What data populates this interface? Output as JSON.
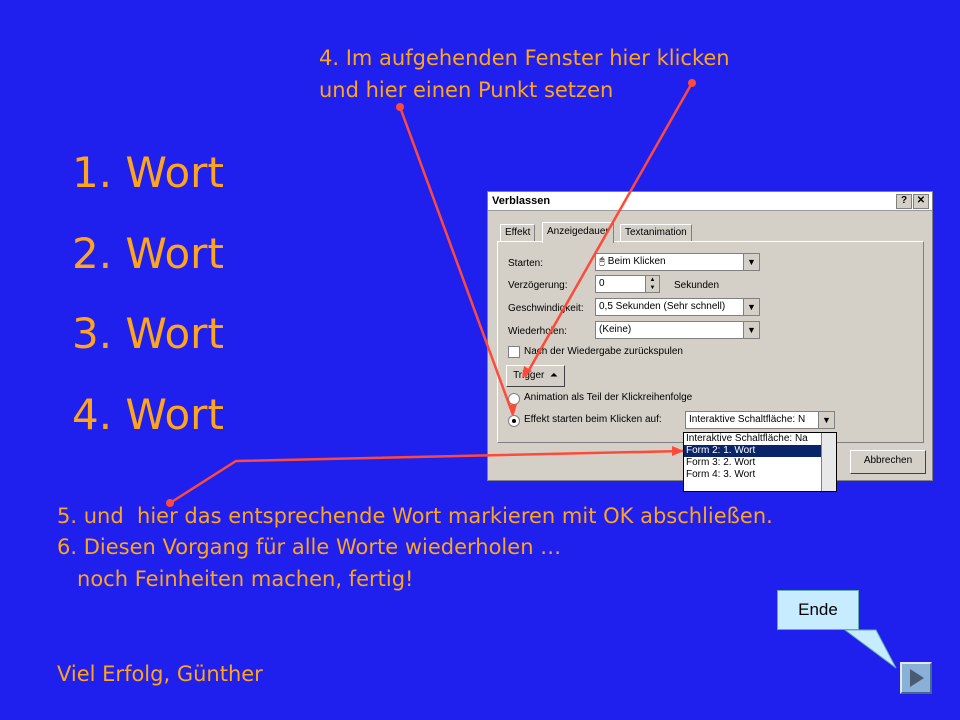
{
  "instructions": {
    "step4_line1": "4. Im aufgehenden Fenster hier klicken",
    "step4_line2": "und hier einen Punkt setzen",
    "step5": "5. und  hier das entsprechende Wort markieren mit OK abschließen.",
    "step6_line1": "6. Diesen Vorgang für alle Worte wiederholen …",
    "step6_line2": "   noch Feinheiten machen, fertig!",
    "signature": "Viel Erfolg, Günther"
  },
  "words": [
    "1. Wort",
    "2. Wort",
    "3. Wort",
    "4. Wort"
  ],
  "dialog": {
    "title": "Verblassen",
    "help_button": "?",
    "close_button": "✕",
    "tabs": [
      "Effekt",
      "Anzeigedauer",
      "Textanimation"
    ],
    "start_label": "Starten:",
    "start_value": "Beim Klicken",
    "delay_label": "Verzögerung:",
    "delay_value": "0",
    "delay_unit": "Sekunden",
    "speed_label": "Geschwindigkeit:",
    "speed_value": "0,5 Sekunden (Sehr schnell)",
    "repeat_label": "Wiederholen:",
    "repeat_value": "(Keine)",
    "rewind_label": "Nach der Wiedergabe zurückspulen",
    "trigger_button": "Trigger",
    "radio_sequence_label": "Animation als Teil der Klickreihenfolge",
    "radio_click_label": "Effekt starten beim Klicken auf:",
    "trigger_select_value": "Interaktive Schaltfläche: N",
    "cancel_button": "Abbrechen",
    "dropdown_icon": "▼"
  },
  "trigger_list": [
    "Interaktive Schaltfläche: Na",
    "Form 2: 1. Wort",
    "Form 3: 2. Wort",
    "Form 4: 3. Wort"
  ],
  "trigger_list_selected_index": 1,
  "callout_label": "Ende",
  "colors": {
    "background": "#2020ee",
    "text": "#ffa41c",
    "arrow": "#ff4a3a"
  }
}
